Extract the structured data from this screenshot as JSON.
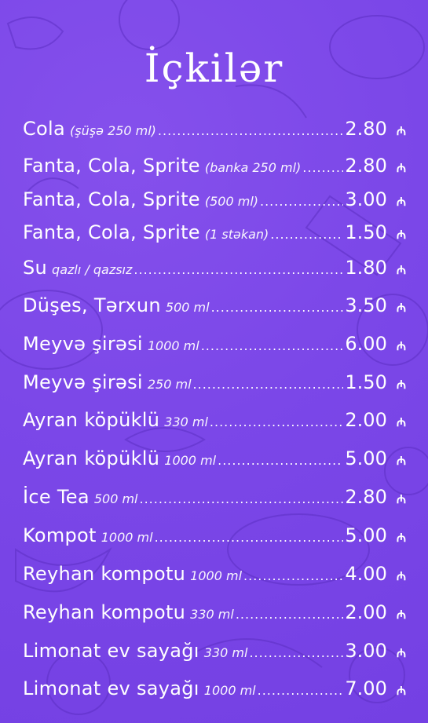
{
  "title": "İçkilər",
  "currency_icon": "manat-sign-icon",
  "currency_symbol": "₼",
  "colors": {
    "background": "#7b47e8",
    "text": "#ffffff"
  },
  "items": [
    {
      "name": "Cola",
      "note": "(şüşə 250 ml)",
      "price": "2.80"
    },
    {
      "name": "Fanta, Cola, Sprite",
      "note": "(banka 250 ml)",
      "price": "2.80"
    },
    {
      "name": "Fanta, Cola, Sprite",
      "note": "(500 ml)",
      "price": "3.00"
    },
    {
      "name": "Fanta, Cola, Sprite",
      "note": "(1 stəkan)",
      "price": "1.50"
    },
    {
      "name": "Su",
      "note": "qazlı / qazsız",
      "price": "1.80"
    },
    {
      "name": "Düşes, Tərxun",
      "note": "500 ml",
      "price": "3.50"
    },
    {
      "name": "Meyvə şirəsi",
      "note": "1000 ml",
      "price": "6.00"
    },
    {
      "name": "Meyvə şirəsi",
      "note": "250 ml",
      "price": "1.50"
    },
    {
      "name": "Ayran köpüklü",
      "note": "330 ml",
      "price": "2.00"
    },
    {
      "name": "Ayran köpüklü",
      "note": "1000 ml",
      "price": "5.00"
    },
    {
      "name": "İce Tea",
      "note": "500 ml",
      "price": "2.80"
    },
    {
      "name": "Kompot",
      "note": "1000 ml",
      "price": "5.00"
    },
    {
      "name": "Reyhan kompotu",
      "note": "1000 ml",
      "price": "4.00"
    },
    {
      "name": "Reyhan kompotu",
      "note": "330 ml",
      "price": "2.00"
    },
    {
      "name": "Limonat ev sayağı",
      "note": "330 ml",
      "price": "3.00"
    },
    {
      "name": "Limonat ev sayağı",
      "note": "1000 ml",
      "price": "7.00"
    }
  ]
}
